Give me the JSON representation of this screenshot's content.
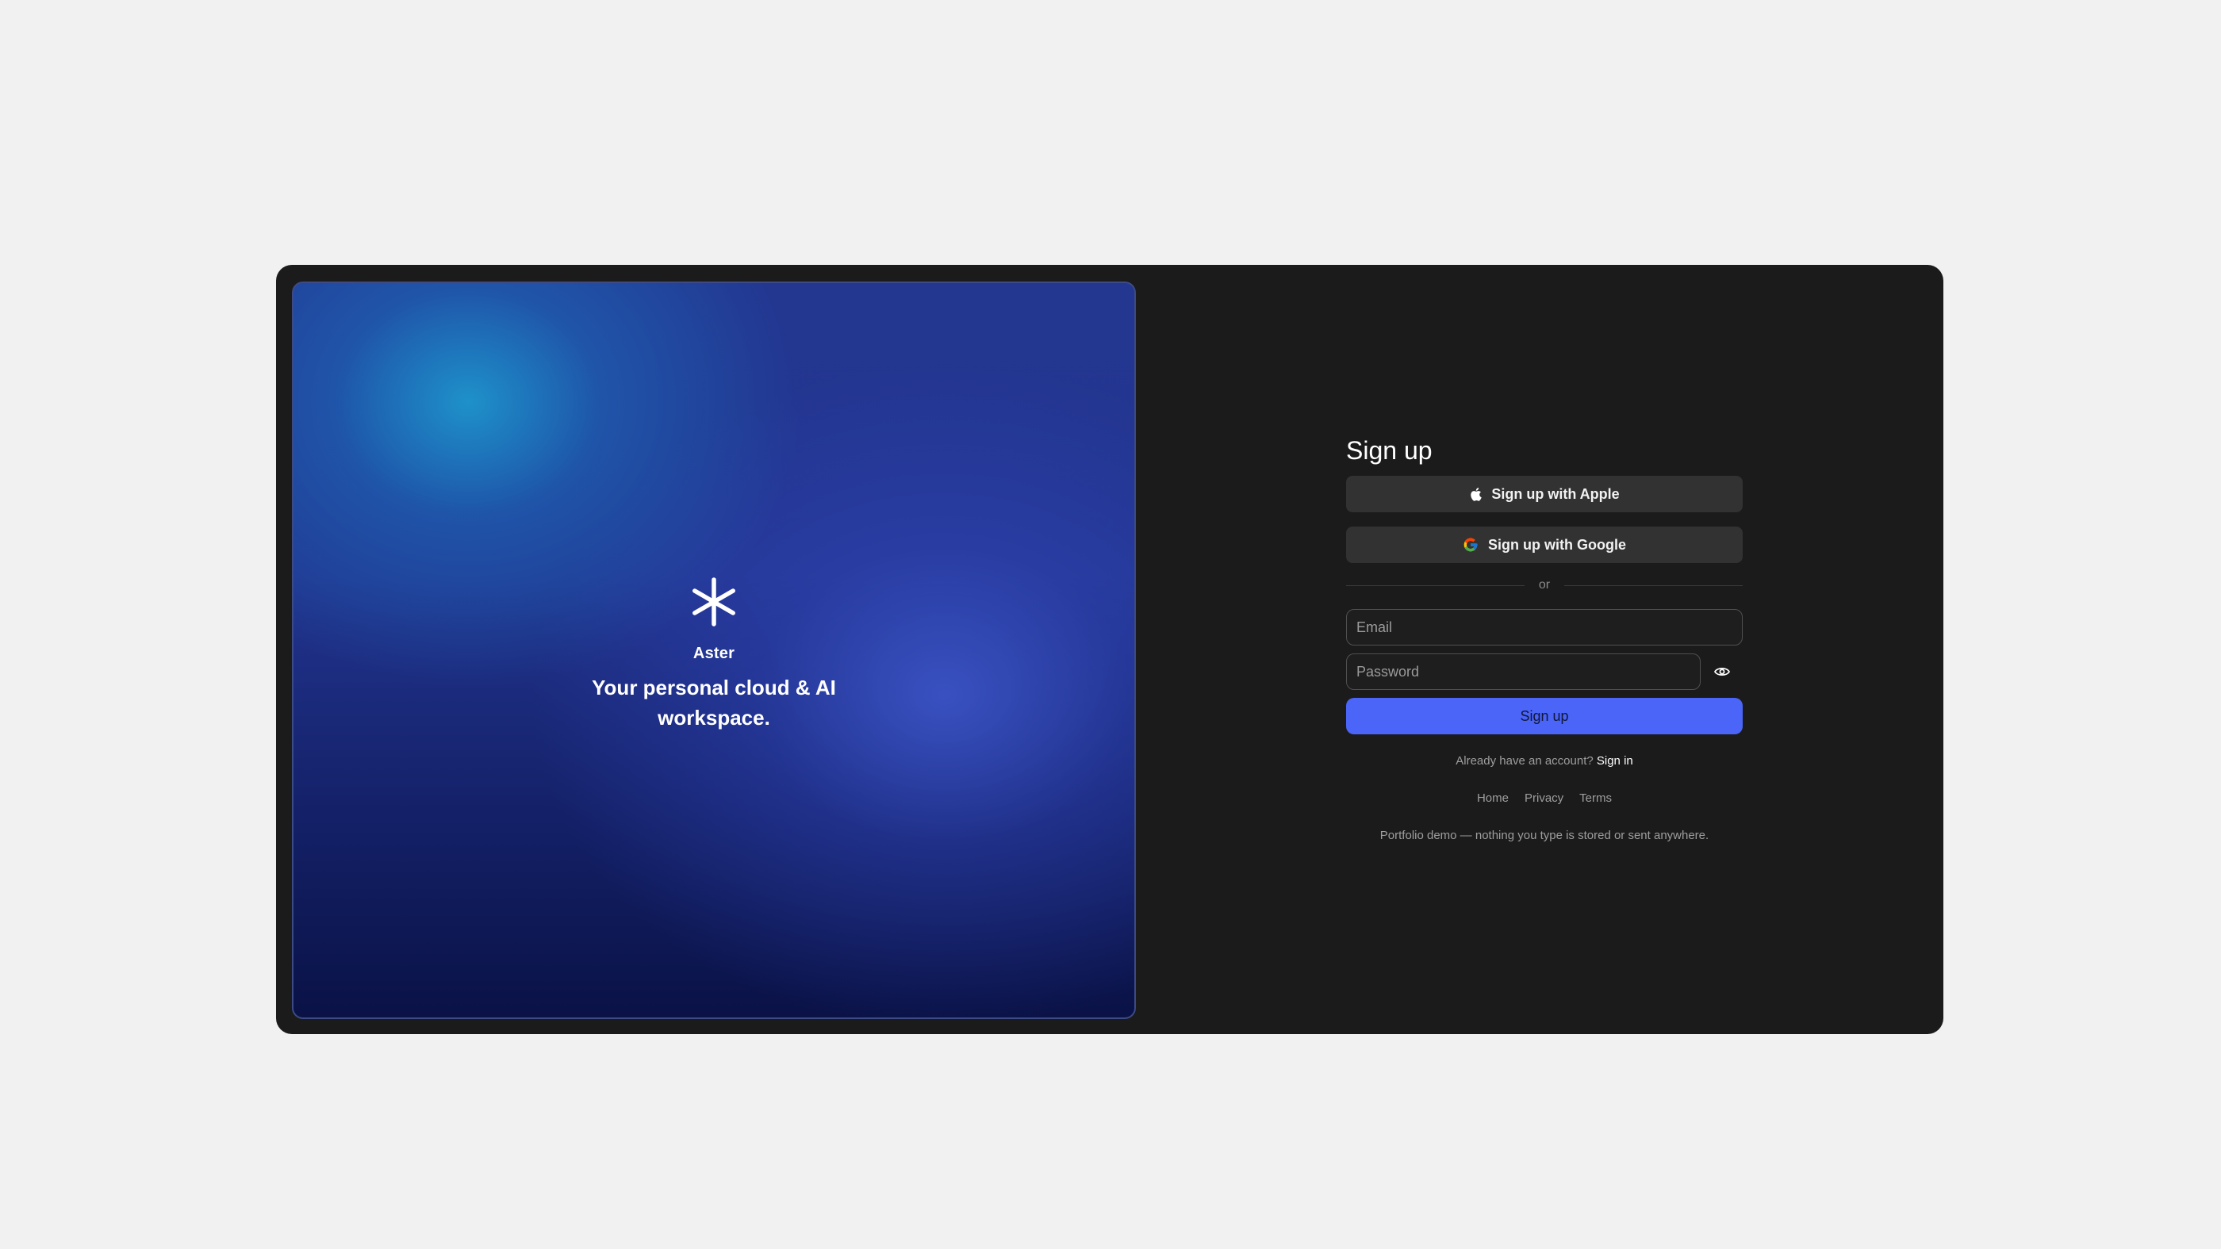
{
  "hero": {
    "brand": "Aster",
    "tagline": "Your personal cloud & AI workspace.",
    "icon": "asterisk-icon"
  },
  "form": {
    "title": "Sign up",
    "apple_button": "Sign up with Apple",
    "google_button": "Sign up with Google",
    "divider": "or",
    "email_placeholder": "Email",
    "password_placeholder": "Password",
    "submit": "Sign up",
    "account_prompt": "Already have an account?",
    "sign_in_link": "Sign in",
    "footer_links": [
      "Home",
      "Privacy",
      "Terms"
    ],
    "disclaimer": "Portfolio demo — nothing you type is stored or sent anywhere."
  },
  "colors": {
    "page_background": "#f1f1f1",
    "card_background": "#1b1b1b",
    "button_background": "#323232",
    "accent": "#4a65f7"
  }
}
